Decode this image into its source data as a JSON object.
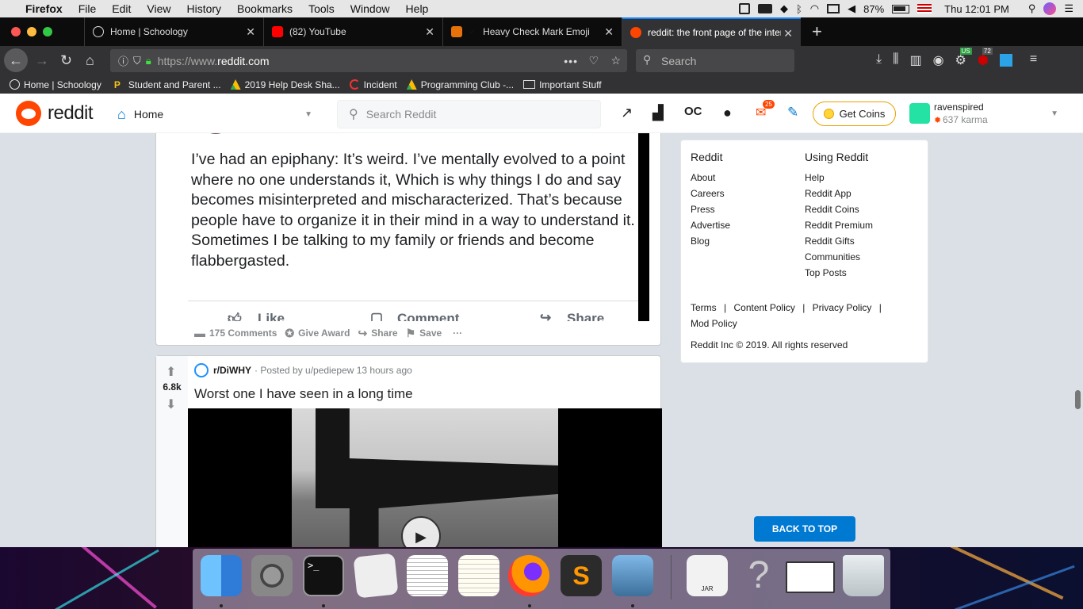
{
  "menubar": {
    "app": "Firefox",
    "items": [
      "File",
      "Edit",
      "View",
      "History",
      "Bookmarks",
      "Tools",
      "Window",
      "Help"
    ],
    "battery": "87%",
    "clock": "Thu 12:01 PM"
  },
  "tabs": [
    {
      "title": "Home | Schoology",
      "color": "#2b6cb0"
    },
    {
      "title": "(82) YouTube",
      "color": "#ff0000"
    },
    {
      "title": "Heavy Check Mark Emoji",
      "color": "#e8710a"
    },
    {
      "title": "reddit: the front page of the internet",
      "color": "#ff4500"
    }
  ],
  "nav": {
    "url_prefix": "https://www.",
    "url_domain": "reddit.com",
    "search_placeholder": "Search",
    "badge_us": "US",
    "badge_72": "72"
  },
  "bookmarks": [
    {
      "label": "Home | Schoology",
      "icon": "schoology-icon"
    },
    {
      "label": "Student and Parent ...",
      "icon": "p-icon"
    },
    {
      "label": "2019 Help Desk Sha...",
      "icon": "drive-icon"
    },
    {
      "label": "Incident",
      "icon": "incident-icon"
    },
    {
      "label": "Programming Club -...",
      "icon": "drive-icon"
    },
    {
      "label": "Important Stuff",
      "icon": "folder-icon"
    }
  ],
  "reddit": {
    "logo_text": "reddit",
    "home_label": "Home",
    "search_placeholder": "Search Reddit",
    "notif_count": "25",
    "get_coins": "Get Coins",
    "username": "ravenspired",
    "karma": "637 karma"
  },
  "post1": {
    "body": "I’ve had an epiphany: It’s weird. I’ve mentally evolved to a point where no one understands it, Which is why things I do and say becomes misinterpreted and mischaracterized. That’s because people have to organize it in their mind in a way to understand it. Sometimes I be talking to my family or friends and become flabbergasted.",
    "fb_like": "Like",
    "fb_comment": "Comment",
    "fb_share": "Share",
    "comments": "175 Comments",
    "give_award": "Give Award",
    "share": "Share",
    "save": "Save",
    "more": "···"
  },
  "post2": {
    "votes": "6.8k",
    "subreddit": "r/DiWHY",
    "posted_by": "· Posted by u/pediepew 13 hours ago",
    "title": "Worst one I have seen in a long time"
  },
  "sidebar": {
    "col1_title": "Reddit",
    "col1": [
      "About",
      "Careers",
      "Press",
      "Advertise",
      "Blog"
    ],
    "col2_title": "Using Reddit",
    "col2": [
      "Help",
      "Reddit App",
      "Reddit Coins",
      "Reddit Premium",
      "Reddit Gifts",
      "Communities",
      "Top Posts"
    ],
    "terms": "Terms",
    "content_policy": "Content Policy",
    "privacy_policy": "Privacy Policy",
    "mod_policy": "Mod Policy",
    "sep": "|",
    "copyright": "Reddit Inc © 2019. All rights reserved",
    "back_to_top": "BACK TO TOP"
  },
  "dock": {
    "jar_label": "JAR"
  }
}
